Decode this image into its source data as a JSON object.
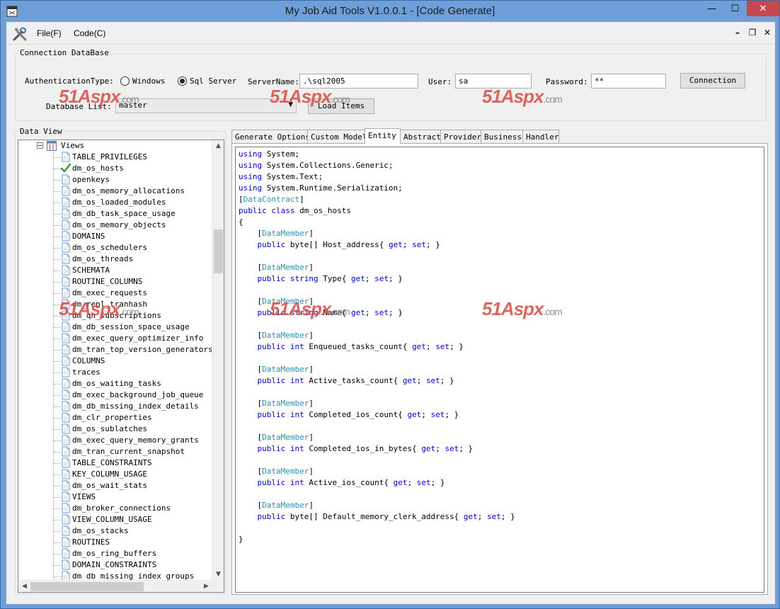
{
  "window": {
    "title": "My Job Aid Tools V1.0.0.1 - [Code Generate]",
    "caption_minimize": "—",
    "caption_maximize": "☐",
    "caption_close": "✕"
  },
  "menu": {
    "file": "File(F)",
    "code": "Code(C)",
    "mdi_minimize": "–",
    "mdi_restore": "❐",
    "mdi_close": "✕"
  },
  "connection": {
    "group_title": "Connection DataBase",
    "auth_label": "AuthenticationType:",
    "radio_windows": "Windows",
    "radio_sqlserver": "Sql Server",
    "radio_selected": "Sql Server",
    "server_label": "ServerName:",
    "server_value": ".\\sql2005",
    "user_label": "User:",
    "user_value": "sa",
    "password_label": "Password:",
    "password_value": "**",
    "connect_button": "Connection",
    "dblist_label": "Database List:",
    "dblist_value": "master",
    "load_button": "Load Items"
  },
  "watermark": {
    "num": "51",
    "brand": "Aspx",
    "suffix": ".com"
  },
  "dataview": {
    "group_title": "Data View",
    "root_label": "Views",
    "selected_item": "dm_os_hosts",
    "items": [
      "TABLE_PRIVILEGES",
      "dm_os_hosts",
      "openkeys",
      "dm_os_memory_allocations",
      "dm_os_loaded_modules",
      "dm_db_task_space_usage",
      "dm_os_memory_objects",
      "DOMAINS",
      "dm_os_schedulers",
      "dm_os_threads",
      "SCHEMATA",
      "ROUTINE_COLUMNS",
      "dm_exec_requests",
      "dm_repl_tranhash",
      "dm_qn_subscriptions",
      "dm_db_session_space_usage",
      "dm_exec_query_optimizer_info",
      "dm_tran_top_version_generators",
      "COLUMNS",
      "traces",
      "dm_os_waiting_tasks",
      "dm_exec_background_job_queue",
      "dm_db_missing_index_details",
      "dm_clr_properties",
      "dm_os_sublatches",
      "dm_exec_query_memory_grants",
      "dm_tran_current_snapshot",
      "TABLE_CONSTRAINTS",
      "KEY_COLUMN_USAGE",
      "dm_os_wait_stats",
      "VIEWS",
      "dm_broker_connections",
      "VIEW_COLUMN_USAGE",
      "dm_os_stacks",
      "ROUTINES",
      "dm_os_ring_buffers",
      "DOMAIN_CONSTRAINTS",
      "dm_db_missing_index_groups"
    ]
  },
  "tabs": {
    "active": "Entity",
    "items": [
      "Generate Options",
      "Custom Model",
      "Entity",
      "Abstract",
      "Provider",
      "Business",
      "Handler"
    ]
  },
  "code": {
    "lines": [
      [
        {
          "t": "using",
          "c": "kw"
        },
        {
          "t": " System;"
        }
      ],
      [
        {
          "t": "using",
          "c": "kw"
        },
        {
          "t": " System.Collections.Generic;"
        }
      ],
      [
        {
          "t": "using",
          "c": "kw"
        },
        {
          "t": " System.Text;"
        }
      ],
      [
        {
          "t": "using",
          "c": "kw"
        },
        {
          "t": " System.Runtime.Serialization;"
        }
      ],
      [
        {
          "t": "["
        },
        {
          "t": "DataContract",
          "c": "attr"
        },
        {
          "t": "]"
        }
      ],
      [
        {
          "t": "public class",
          "c": "kw"
        },
        {
          "t": " dm_os_hosts"
        }
      ],
      [
        {
          "t": "{"
        }
      ],
      [
        {
          "t": "    ["
        },
        {
          "t": "DataMember",
          "c": "attr"
        },
        {
          "t": "]"
        }
      ],
      [
        {
          "t": "    "
        },
        {
          "t": "public",
          "c": "kw"
        },
        {
          "t": " byte[] Host_address{ "
        },
        {
          "t": "get",
          "c": "kw"
        },
        {
          "t": "; "
        },
        {
          "t": "set",
          "c": "kw"
        },
        {
          "t": "; }"
        }
      ],
      [
        {
          "t": ""
        }
      ],
      [
        {
          "t": "    ["
        },
        {
          "t": "DataMember",
          "c": "attr"
        },
        {
          "t": "]"
        }
      ],
      [
        {
          "t": "    "
        },
        {
          "t": "public string",
          "c": "kw"
        },
        {
          "t": " Type{ "
        },
        {
          "t": "get",
          "c": "kw"
        },
        {
          "t": "; "
        },
        {
          "t": "set",
          "c": "kw"
        },
        {
          "t": "; }"
        }
      ],
      [
        {
          "t": ""
        }
      ],
      [
        {
          "t": "    ["
        },
        {
          "t": "DataMember",
          "c": "attr"
        },
        {
          "t": "]"
        }
      ],
      [
        {
          "t": "    "
        },
        {
          "t": "public string",
          "c": "kw"
        },
        {
          "t": " Name{ "
        },
        {
          "t": "get",
          "c": "kw"
        },
        {
          "t": "; "
        },
        {
          "t": "set",
          "c": "kw"
        },
        {
          "t": "; }"
        }
      ],
      [
        {
          "t": ""
        }
      ],
      [
        {
          "t": "    ["
        },
        {
          "t": "DataMember",
          "c": "attr"
        },
        {
          "t": "]"
        }
      ],
      [
        {
          "t": "    "
        },
        {
          "t": "public int",
          "c": "kw"
        },
        {
          "t": " Enqueued_tasks_count{ "
        },
        {
          "t": "get",
          "c": "kw"
        },
        {
          "t": "; "
        },
        {
          "t": "set",
          "c": "kw"
        },
        {
          "t": "; }"
        }
      ],
      [
        {
          "t": ""
        }
      ],
      [
        {
          "t": "    ["
        },
        {
          "t": "DataMember",
          "c": "attr"
        },
        {
          "t": "]"
        }
      ],
      [
        {
          "t": "    "
        },
        {
          "t": "public int",
          "c": "kw"
        },
        {
          "t": " Active_tasks_count{ "
        },
        {
          "t": "get",
          "c": "kw"
        },
        {
          "t": "; "
        },
        {
          "t": "set",
          "c": "kw"
        },
        {
          "t": "; }"
        }
      ],
      [
        {
          "t": ""
        }
      ],
      [
        {
          "t": "    ["
        },
        {
          "t": "DataMember",
          "c": "attr"
        },
        {
          "t": "]"
        }
      ],
      [
        {
          "t": "    "
        },
        {
          "t": "public int",
          "c": "kw"
        },
        {
          "t": " Completed_ios_count{ "
        },
        {
          "t": "get",
          "c": "kw"
        },
        {
          "t": "; "
        },
        {
          "t": "set",
          "c": "kw"
        },
        {
          "t": "; }"
        }
      ],
      [
        {
          "t": ""
        }
      ],
      [
        {
          "t": "    ["
        },
        {
          "t": "DataMember",
          "c": "attr"
        },
        {
          "t": "]"
        }
      ],
      [
        {
          "t": "    "
        },
        {
          "t": "public int",
          "c": "kw"
        },
        {
          "t": " Completed_ios_in_bytes{ "
        },
        {
          "t": "get",
          "c": "kw"
        },
        {
          "t": "; "
        },
        {
          "t": "set",
          "c": "kw"
        },
        {
          "t": "; }"
        }
      ],
      [
        {
          "t": ""
        }
      ],
      [
        {
          "t": "    ["
        },
        {
          "t": "DataMember",
          "c": "attr"
        },
        {
          "t": "]"
        }
      ],
      [
        {
          "t": "    "
        },
        {
          "t": "public int",
          "c": "kw"
        },
        {
          "t": " Active_ios_count{ "
        },
        {
          "t": "get",
          "c": "kw"
        },
        {
          "t": "; "
        },
        {
          "t": "set",
          "c": "kw"
        },
        {
          "t": "; }"
        }
      ],
      [
        {
          "t": ""
        }
      ],
      [
        {
          "t": "    ["
        },
        {
          "t": "DataMember",
          "c": "attr"
        },
        {
          "t": "]"
        }
      ],
      [
        {
          "t": "    "
        },
        {
          "t": "public",
          "c": "kw"
        },
        {
          "t": " byte[] Default_memory_clerk_address{ "
        },
        {
          "t": "get",
          "c": "kw"
        },
        {
          "t": "; "
        },
        {
          "t": "set",
          "c": "kw"
        },
        {
          "t": "; }"
        }
      ],
      [
        {
          "t": ""
        }
      ],
      [
        {
          "t": "}"
        }
      ]
    ]
  },
  "colors": {
    "keyword": "#0000cc",
    "attribute": "#2b91af",
    "watermark": "#d64c42",
    "titlebar": "#6f9fd8"
  }
}
